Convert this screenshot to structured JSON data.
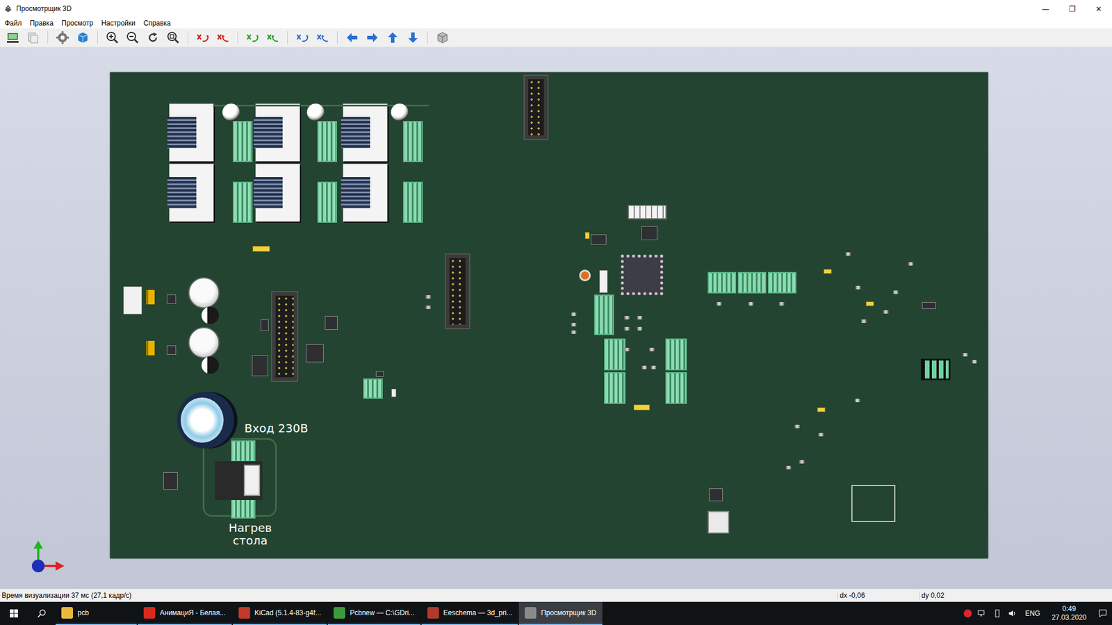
{
  "window": {
    "title": "Просмотрщик 3D",
    "controls": [
      "—",
      "❐",
      "✕"
    ]
  },
  "menu": [
    "Файл",
    "Правка",
    "Просмотр",
    "Настройки",
    "Справка"
  ],
  "board": {
    "labels": [
      {
        "lines": [
          "Вход 230В"
        ]
      },
      {
        "lines": [
          "Нагрев",
          "стола"
        ]
      }
    ]
  },
  "status_bar": {
    "render_time": "Время визуализации 37 мс (27,1 кадр/с)",
    "dx": "dx -0,06",
    "dy": "dy 0,02"
  },
  "taskbar": {
    "items": [
      {
        "label": "pcb",
        "selected": false,
        "color": "#e8b93a"
      },
      {
        "label": "АнимациЯ - Белая...",
        "selected": false,
        "color": "#d52b1e"
      },
      {
        "label": "KiCad (5.1.4-83-g4f...",
        "selected": false,
        "color": "#c0392b"
      },
      {
        "label": "Pcbnew — C:\\GDri...",
        "selected": false,
        "color": "#3c9a3c"
      },
      {
        "label": "Eeschema — 3d_pri...",
        "selected": false,
        "color": "#b03a2e"
      },
      {
        "label": "Просмотрщик 3D",
        "selected": true,
        "color": "#8a8a8a"
      }
    ],
    "tray": {
      "lang": "ENG",
      "time": "0:49",
      "date": "27.03.2020"
    }
  }
}
